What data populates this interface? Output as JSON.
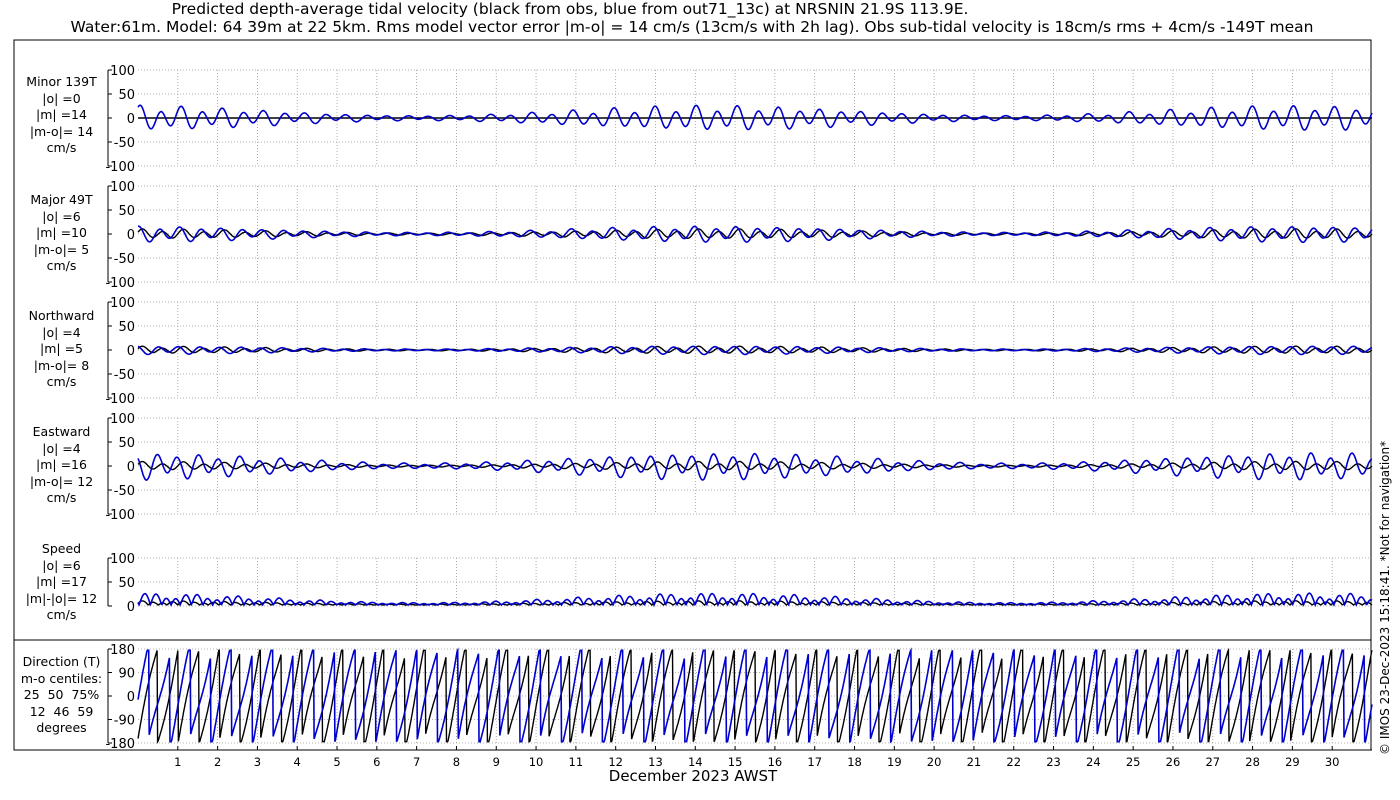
{
  "title_line1": "Predicted depth-average tidal velocity (black from obs, blue from out71_13c) at NRSNIN 21.9S 113.9E.",
  "title_line2": "Water:61m. Model: 64 39m at 22 5km. Rms model vector error |m-o| = 14 cm/s (13cm/s with 2h lag). Obs sub-tidal velocity is 18cm/s rms + 4cm/s -149T mean",
  "xlabel": "December 2023 AWST",
  "credit": "© IMOS 23-Dec-2023 15:18:41. *Not for navigation*",
  "colors": {
    "obs": "#000000",
    "model": "#0000cc",
    "grid": "#9a9a9a"
  },
  "chart_data": [
    {
      "type": "line",
      "panel": "minor",
      "label": "Minor 139T\n|o| =0\n|m| =14\n|m-o|= 14\ncm/s",
      "ylim": [
        -100,
        100
      ],
      "yticks": [
        "100",
        "50",
        "0",
        "-50",
        "-100"
      ],
      "xlim": [
        0,
        31
      ],
      "grid": "dotted",
      "series": [
        {
          "role": "obs",
          "amplitude_cms": 0
        },
        {
          "role": "model",
          "amplitude_cms": 20
        }
      ]
    },
    {
      "type": "line",
      "panel": "major",
      "label": "Major 49T\n|o| =6\n|m| =10\n|m-o|= 5\ncm/s",
      "ylim": [
        -100,
        100
      ],
      "yticks": [
        "100",
        "50",
        "0",
        "-50",
        "-100"
      ],
      "xlim": [
        0,
        31
      ],
      "grid": "dotted",
      "series": [
        {
          "role": "obs",
          "amplitude_cms": 8
        },
        {
          "role": "model",
          "amplitude_cms": 13
        }
      ]
    },
    {
      "type": "line",
      "panel": "northward",
      "label": "Northward\n|o| =4\n|m| =5\n|m-o|= 8\ncm/s",
      "ylim": [
        -100,
        100
      ],
      "yticks": [
        "100",
        "50",
        "0",
        "-50",
        "-100"
      ],
      "xlim": [
        0,
        31
      ],
      "grid": "dotted",
      "series": [
        {
          "role": "obs",
          "amplitude_cms": 6
        },
        {
          "role": "model",
          "amplitude_cms": 7
        }
      ]
    },
    {
      "type": "line",
      "panel": "eastward",
      "label": "Eastward\n|o| =4\n|m| =16\n|m-o|= 12\ncm/s",
      "ylim": [
        -100,
        100
      ],
      "yticks": [
        "100",
        "50",
        "0",
        "-50",
        "-100"
      ],
      "xlim": [
        0,
        31
      ],
      "grid": "dotted",
      "series": [
        {
          "role": "obs",
          "amplitude_cms": 7
        },
        {
          "role": "model",
          "amplitude_cms": 22
        }
      ]
    },
    {
      "type": "line",
      "panel": "speed",
      "label": "Speed\n|o| =6\n|m| =17\n|m|-|o|= 12\ncm/s",
      "ylim": [
        0,
        100
      ],
      "yticks": [
        "100",
        "50",
        "0"
      ],
      "xlim": [
        0,
        31
      ],
      "grid": "dotted",
      "series": [
        {
          "role": "obs",
          "amplitude_cms": 6
        },
        {
          "role": "model",
          "amplitude_cms": 17
        }
      ]
    },
    {
      "type": "line",
      "panel": "direction",
      "label": "Direction (T)\nm-o centiles:\n25  50  75%\n12  46  59\ndegrees",
      "ylim": [
        -180,
        180
      ],
      "yticks": [
        "180",
        "90",
        "0",
        "-90",
        "-180"
      ],
      "xlim": [
        0,
        31
      ],
      "grid": "dotted",
      "series": [
        {
          "role": "obs",
          "units": "degrees"
        },
        {
          "role": "model",
          "units": "degrees"
        }
      ]
    }
  ],
  "x_ticks": [
    "1",
    "2",
    "3",
    "4",
    "5",
    "6",
    "7",
    "8",
    "9",
    "10",
    "11",
    "12",
    "13",
    "14",
    "15",
    "16",
    "17",
    "18",
    "19",
    "20",
    "21",
    "22",
    "23",
    "24",
    "25",
    "26",
    "27",
    "28",
    "29",
    "30"
  ]
}
